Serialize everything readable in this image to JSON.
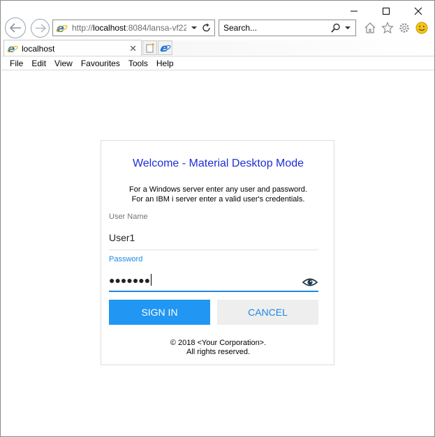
{
  "browser": {
    "address": {
      "prefix": "http://",
      "host": "localhost",
      "rest": ":8084/lansa-vf22"
    },
    "search_placeholder": "Search...",
    "tab": {
      "label": "localhost"
    },
    "menu": [
      "File",
      "Edit",
      "View",
      "Favourites",
      "Tools",
      "Help"
    ],
    "colors": {
      "ie_blue": "#1e74d1",
      "smiley": "#f5c518"
    }
  },
  "login": {
    "title": "Welcome - Material Desktop Mode",
    "desc_line1": "For a Windows server enter any user and password.",
    "desc_line2": "For an IBM i server enter a valid user's credentials.",
    "username_label": "User Name",
    "username_value": "User1",
    "password_label": "Password",
    "password_mask": "●●●●●●●",
    "signin_label": "SIGN IN",
    "cancel_label": "CANCEL",
    "copyright_line1": "© 2018 <Your Corporation>.",
    "copyright_line2": "All rights reserved.",
    "colors": {
      "title": "#1e2fd6",
      "primary": "#2196f3",
      "accent": "#1e88e5"
    }
  }
}
